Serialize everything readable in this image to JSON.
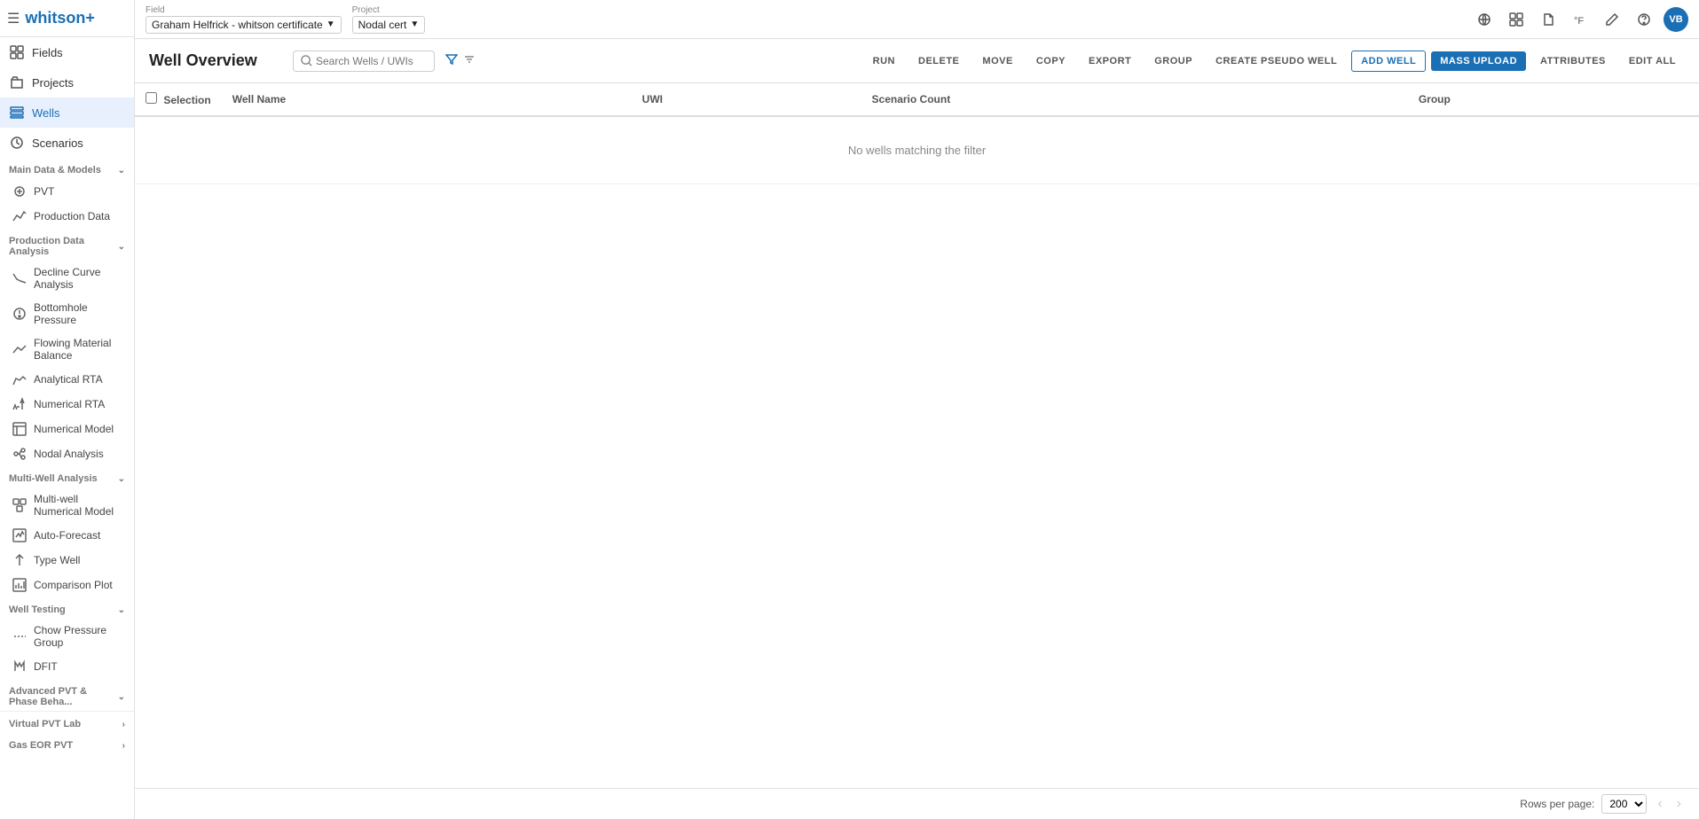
{
  "app": {
    "name": "whitson",
    "name_plus": "+"
  },
  "topbar": {
    "field_label": "Field",
    "field_value": "Graham Helfrick - whitson certificate",
    "project_label": "Project",
    "project_value": "Nodal cert"
  },
  "sidebar": {
    "top_items": [
      {
        "id": "fields",
        "label": "Fields",
        "icon": "grid"
      },
      {
        "id": "projects",
        "label": "Projects",
        "icon": "folder"
      },
      {
        "id": "wells",
        "label": "Wells",
        "icon": "list",
        "active": true
      }
    ],
    "sections": [
      {
        "id": "main-data",
        "label": "Main Data & Models",
        "collapsed": false,
        "items": [
          {
            "id": "pvt",
            "label": "PVT",
            "icon": "molecule"
          },
          {
            "id": "production-data",
            "label": "Production Data",
            "icon": "trend"
          }
        ]
      },
      {
        "id": "production-analysis",
        "label": "Production Data Analysis",
        "collapsed": false,
        "items": [
          {
            "id": "decline-curve",
            "label": "Decline Curve Analysis",
            "icon": "decline"
          },
          {
            "id": "bottomhole",
            "label": "Bottomhole Pressure",
            "icon": "gauge"
          },
          {
            "id": "flowing-material",
            "label": "Flowing Material Balance",
            "icon": "balance"
          },
          {
            "id": "analytical-rta",
            "label": "Analytical RTA",
            "icon": "rta"
          },
          {
            "id": "numerical-rta",
            "label": "Numerical RTA",
            "icon": "num-rta"
          },
          {
            "id": "numerical-model",
            "label": "Numerical Model",
            "icon": "num-model"
          },
          {
            "id": "nodal-analysis",
            "label": "Nodal Analysis",
            "icon": "nodal"
          }
        ]
      },
      {
        "id": "multi-well",
        "label": "Multi-Well Analysis",
        "collapsed": false,
        "items": [
          {
            "id": "multi-well-numerical",
            "label": "Multi-well Numerical Model",
            "icon": "multi-num"
          },
          {
            "id": "auto-forecast",
            "label": "Auto-Forecast",
            "icon": "auto-forecast"
          },
          {
            "id": "type-well",
            "label": "Type Well",
            "icon": "type-well"
          },
          {
            "id": "comparison-plot",
            "label": "Comparison Plot",
            "icon": "comparison"
          }
        ]
      },
      {
        "id": "well-testing",
        "label": "Well Testing",
        "collapsed": false,
        "items": [
          {
            "id": "chow-pressure",
            "label": "Chow Pressure Group",
            "icon": "chow"
          },
          {
            "id": "dfit",
            "label": "DFIT",
            "icon": "dfit"
          }
        ]
      },
      {
        "id": "pvt-phase",
        "label": "Advanced PVT & Phase Beha...",
        "collapsed": false,
        "items": []
      },
      {
        "id": "virtual-pvt",
        "label": "Virtual PVT Lab",
        "collapsed": true,
        "items": []
      },
      {
        "id": "gas-eor",
        "label": "Gas EOR PVT",
        "collapsed": true,
        "items": []
      }
    ]
  },
  "page": {
    "title": "Well Overview",
    "search_placeholder": "Search Wells / UWIs"
  },
  "table": {
    "columns": [
      "Selection",
      "Well Name",
      "UWI",
      "Scenario Count",
      "Group"
    ],
    "no_data_message": "No wells matching the filter",
    "rows_per_page_label": "Rows per page:",
    "rows_per_page_value": "200"
  },
  "actions": {
    "run": "RUN",
    "delete": "DELETE",
    "move": "MOVE",
    "copy": "COPY",
    "export": "EXPORT",
    "group": "GROUP",
    "create_pseudo_well": "CREATE PSEUDO WELL",
    "add_well": "ADD WELL",
    "mass_upload": "MASS UPLOAD",
    "attributes": "ATTRIBUTES",
    "edit_all": "EDIT ALL"
  }
}
